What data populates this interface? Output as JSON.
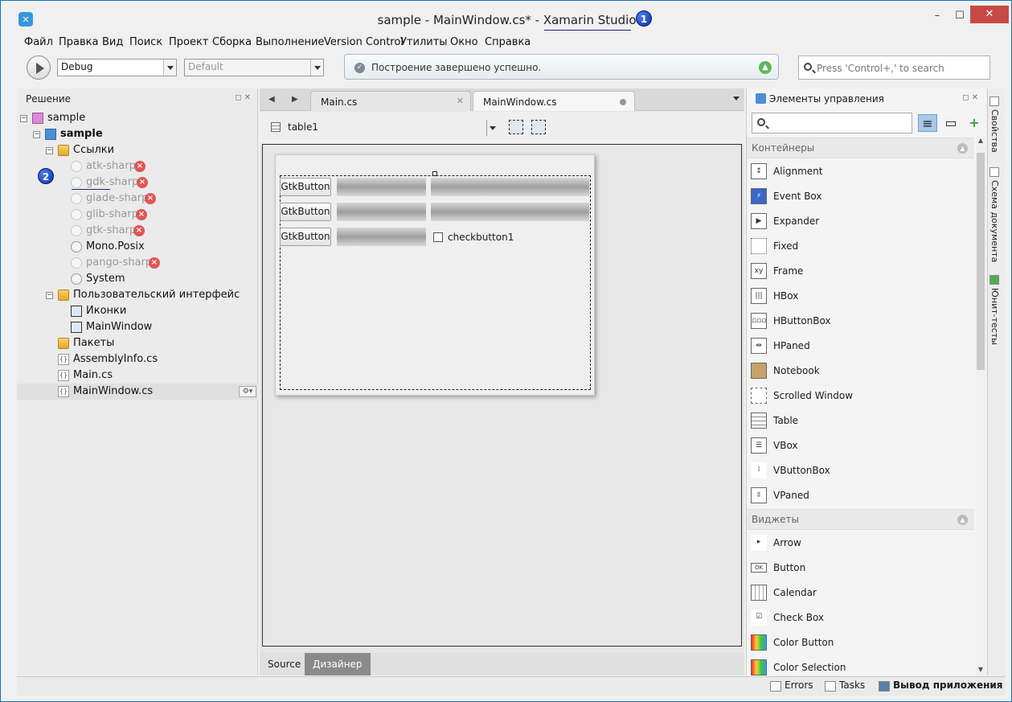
{
  "window": {
    "title": "sample - MainWindow.cs* - Xamarin Studio",
    "controls": {
      "minimize": "–",
      "maximize": "☐",
      "close": "✕"
    }
  },
  "callouts": [
    "1",
    "2"
  ],
  "menu": [
    "Файл",
    "Правка",
    "Вид",
    "Поиск",
    "Проект",
    "Сборка",
    "Выполнение",
    "Version Control",
    "Утилиты",
    "Окно",
    "Справка"
  ],
  "toolbar": {
    "config": "Debug",
    "platform": "Default",
    "status_message": "Построение завершено успешно.",
    "search_placeholder": "Press 'Control+,' to search"
  },
  "solution_pad": {
    "title": "Решение",
    "tree": [
      {
        "label": "sample",
        "level": 0,
        "icon": "solution-icon",
        "expanded": true
      },
      {
        "label": "sample",
        "level": 1,
        "icon": "project-icon",
        "expanded": true,
        "bold": true
      },
      {
        "label": "Ссылки",
        "level": 2,
        "icon": "folder-icon",
        "expanded": true
      },
      {
        "label": "atk-sharp",
        "level": 3,
        "icon": "reference-icon",
        "error": true
      },
      {
        "label": "gdk-sharp",
        "level": 3,
        "icon": "reference-icon",
        "error": true
      },
      {
        "label": "glade-sharp",
        "level": 3,
        "icon": "reference-icon",
        "error": true
      },
      {
        "label": "glib-sharp",
        "level": 3,
        "icon": "reference-icon",
        "error": true
      },
      {
        "label": "gtk-sharp",
        "level": 3,
        "icon": "reference-icon",
        "error": true
      },
      {
        "label": "Mono.Posix",
        "level": 3,
        "icon": "reference-icon",
        "error": false
      },
      {
        "label": "pango-sharp",
        "level": 3,
        "icon": "reference-icon",
        "error": true
      },
      {
        "label": "System",
        "level": 3,
        "icon": "reference-icon",
        "error": false
      },
      {
        "label": "Пользовательский интерфейс",
        "level": 2,
        "icon": "folder-icon",
        "expanded": true
      },
      {
        "label": "Иконки",
        "level": 3,
        "icon": "image-icon"
      },
      {
        "label": "MainWindow",
        "level": 3,
        "icon": "window-icon"
      },
      {
        "label": "Пакеты",
        "level": 2,
        "icon": "folder-icon"
      },
      {
        "label": "AssemblyInfo.cs",
        "level": 2,
        "icon": "file-icon"
      },
      {
        "label": "Main.cs",
        "level": 2,
        "icon": "file-icon"
      },
      {
        "label": "MainWindow.cs",
        "level": 2,
        "icon": "file-icon",
        "selected": true
      }
    ]
  },
  "editor": {
    "tabs": [
      {
        "label": "Main.cs",
        "active": false
      },
      {
        "label": "MainWindow.cs",
        "active": true
      }
    ],
    "designer_widget": "table1",
    "buttons": [
      "GtkButton",
      "GtkButton",
      "GtkButton"
    ],
    "checkbutton_label": "checkbutton1",
    "bottom_tabs": [
      {
        "label": "Source",
        "active": false
      },
      {
        "label": "Дизайнер",
        "active": true
      }
    ]
  },
  "toolbox": {
    "title": "Элементы управления",
    "sections": [
      {
        "title": "Контейнеры",
        "items": [
          "Alignment",
          "Event Box",
          "Expander",
          "Fixed",
          "Frame",
          "HBox",
          "HButtonBox",
          "HPaned",
          "Notebook",
          "Scrolled Window",
          "Table",
          "VBox",
          "VButtonBox",
          "VPaned"
        ]
      },
      {
        "title": "Виджеты",
        "items": [
          "Arrow",
          "Button",
          "Calendar",
          "Check Box",
          "Color Button",
          "Color Selection"
        ]
      }
    ]
  },
  "side_tabs": [
    "Свойства",
    "Схема документа",
    "Юнит-тесты"
  ],
  "statusbar": {
    "items": [
      "Errors",
      "Tasks",
      "Вывод приложения"
    ]
  }
}
